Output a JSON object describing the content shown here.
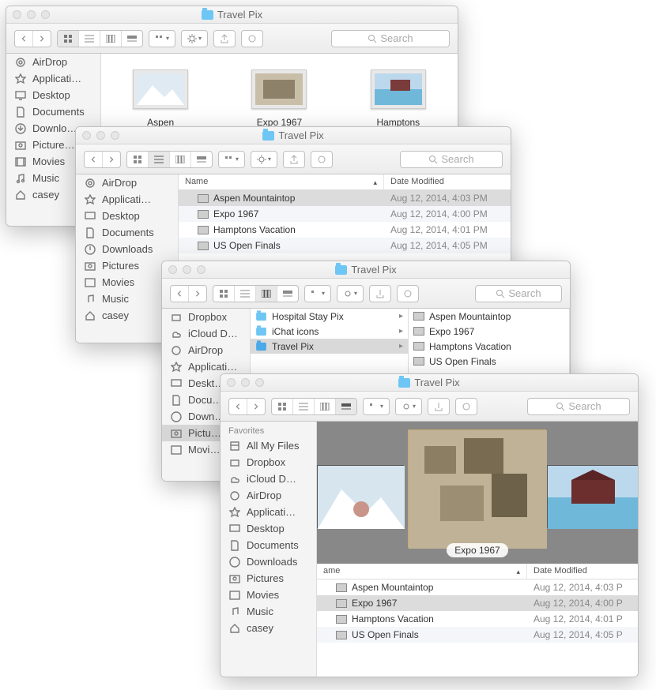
{
  "common": {
    "search_placeholder": "Search",
    "folder_title": "Travel Pix"
  },
  "sidebar": {
    "favorites_label": "Favorites",
    "items_w1": [
      "AirDrop",
      "Applicati…",
      "Desktop",
      "Documents",
      "Downlo…",
      "Picture…",
      "Movies",
      "Music",
      "casey"
    ],
    "items_w2": [
      "AirDrop",
      "Applicati…",
      "Desktop",
      "Documents",
      "Downloads",
      "Pictures",
      "Movies",
      "Music",
      "casey"
    ],
    "items_w3": [
      "Dropbox",
      "iCloud D…",
      "AirDrop",
      "Applicati…",
      "Deskt…",
      "Docu…",
      "Down…",
      "Pictu…",
      "Movi…"
    ],
    "items_w4": [
      "All My Files",
      "Dropbox",
      "iCloud D…",
      "AirDrop",
      "Applicati…",
      "Desktop",
      "Documents",
      "Downloads",
      "Pictures",
      "Movies",
      "Music",
      "casey"
    ]
  },
  "w1": {
    "files": [
      "Aspen Mountaintop",
      "Expo 1967",
      "Hamptons Vacation"
    ]
  },
  "columns": {
    "name": "Name",
    "date": "Date Modified"
  },
  "list": {
    "rows": [
      {
        "name": "Aspen Mountaintop",
        "date": "Aug 12, 2014, 4:03 PM"
      },
      {
        "name": "Expo 1967",
        "date": "Aug 12, 2014, 4:00 PM"
      },
      {
        "name": "Hamptons Vacation",
        "date": "Aug 12, 2014, 4:01 PM"
      },
      {
        "name": "US Open Finals",
        "date": "Aug 12, 2014, 4:05 PM"
      }
    ]
  },
  "w3": {
    "col1": [
      "Hospital Stay Pix",
      "iChat icons",
      "Travel Pix"
    ],
    "col2": [
      "Aspen Mountaintop",
      "Expo 1967",
      "Hamptons Vacation",
      "US Open Finals"
    ]
  },
  "w4": {
    "coverflow_caption": "Expo 1967",
    "rows": [
      {
        "name": "Aspen Mountaintop",
        "date": "Aug 12, 2014, 4:03 P"
      },
      {
        "name": "Expo 1967",
        "date": "Aug 12, 2014, 4:00 P"
      },
      {
        "name": "Hamptons Vacation",
        "date": "Aug 12, 2014, 4:01 P"
      },
      {
        "name": "US Open Finals",
        "date": "Aug 12, 2014, 4:05 P"
      }
    ],
    "col_name": "ame",
    "col_date": "Date Modified"
  }
}
